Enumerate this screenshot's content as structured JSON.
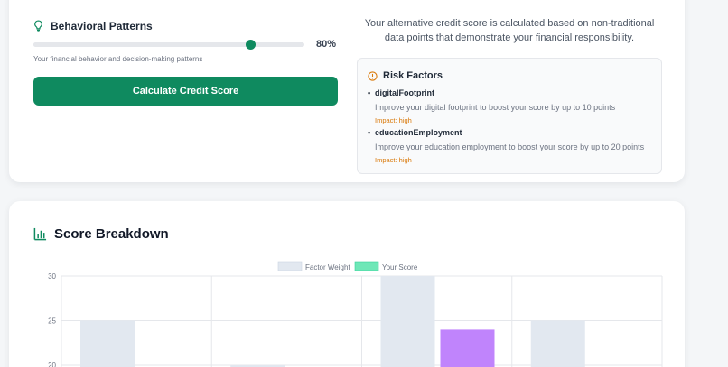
{
  "behavioral": {
    "title": "Behavioral Patterns",
    "value": 80,
    "value_label": "80%",
    "help": "Your financial behavior and decision-making patterns",
    "icon": "lightbulb-icon"
  },
  "calculate_button": "Calculate Credit Score",
  "intro": "Your alternative credit score is calculated based on non-traditional data points that demonstrate your financial responsibility.",
  "risk_factors": {
    "title": "Risk Factors",
    "icon": "alert-circle-icon",
    "items": [
      {
        "name": "digitalFootprint",
        "description": "Improve your digital footprint to boost your score by up to 10 points",
        "impact": "Impact: high"
      },
      {
        "name": "educationEmployment",
        "description": "Improve your education employment to boost your score by up to 20 points",
        "impact": "Impact: high"
      }
    ]
  },
  "score_breakdown": {
    "title": "Score Breakdown",
    "icon": "bar-chart-icon"
  },
  "colors": {
    "primary": "#0f8a5f",
    "accent_amber": "#d97706",
    "weight_bar": "#e2e8f0",
    "score_legend": "#6ee7b7",
    "score_bar_purple": "#c084fc"
  },
  "chart_data": {
    "type": "bar",
    "legend": [
      "Factor Weight",
      "Your Score"
    ],
    "y_ticks": [
      "30",
      "25",
      "20"
    ],
    "ylim_visible": [
      20,
      30
    ],
    "series": [
      {
        "name": "Factor Weight",
        "values": [
          25,
          20,
          30,
          25
        ]
      },
      {
        "name": "Your Score",
        "values": [
          null,
          null,
          24,
          null
        ]
      }
    ]
  }
}
